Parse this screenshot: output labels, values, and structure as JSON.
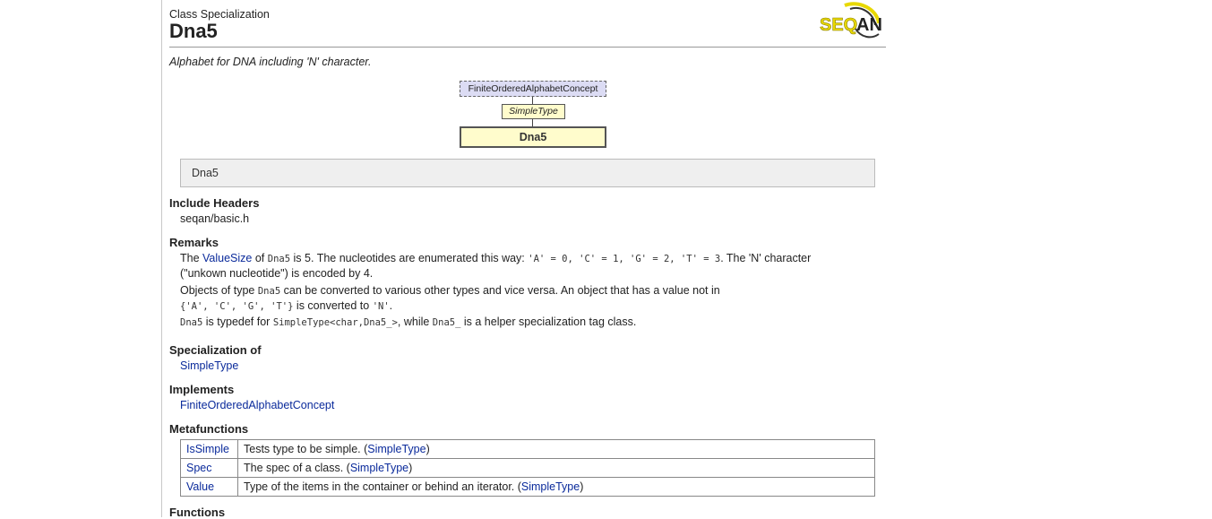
{
  "header": {
    "kind": "Class Specialization",
    "title": "Dna5",
    "logo_text": "SEQAN"
  },
  "summary": "Alphabet for DNA including 'N' character.",
  "diagram": {
    "concept": "FiniteOrderedAlphabetConcept",
    "parent": "SimpleType",
    "self": "Dna5"
  },
  "signature": "Dna5",
  "include": {
    "heading": "Include Headers",
    "header": "seqan/basic.h"
  },
  "remarks": {
    "heading": "Remarks",
    "p1": {
      "t1": "The ",
      "link": "ValueSize",
      "t2": " of ",
      "code1": "Dna5",
      "t3": " is 5. The nucleotides are enumerated this way: ",
      "code2": "'A' = 0, 'C' = 1, 'G' = 2, 'T' = 3",
      "t4": ". The 'N' character",
      "line2": "(\"unkown nucleotide\") is encoded by 4."
    },
    "p2": {
      "t1": "Objects of type ",
      "code1": "Dna5",
      "t2": " can be converted to various other types and vice versa. An object that has a value not in",
      "code2": "{'A', 'C', 'G', 'T'}",
      "t3": " is converted to ",
      "code3": "'N'",
      "t4": "."
    },
    "p3": {
      "code1": "Dna5",
      "t1": " is typedef for ",
      "code2": "SimpleType<char,Dna5_>",
      "t2": ", while ",
      "code3": "Dna5_",
      "t3": " is a helper specialization tag class."
    }
  },
  "specialization": {
    "heading": "Specialization of",
    "link": "SimpleType"
  },
  "implements": {
    "heading": "Implements",
    "link": "FiniteOrderedAlphabetConcept"
  },
  "metafunctions": {
    "heading": "Metafunctions",
    "rows": [
      {
        "name": "IsSimple",
        "desc": "Tests type to be simple. (",
        "link": "SimpleType",
        "end": ")"
      },
      {
        "name": "Spec",
        "desc": "The spec of a class. (",
        "link": "SimpleType",
        "end": ")"
      },
      {
        "name": "Value",
        "desc": "Type of the items in the container or behind an iterator. (",
        "link": "SimpleType",
        "end": ")"
      }
    ]
  },
  "functions": {
    "heading": "Functions"
  },
  "colors": {
    "link": "#0a2a9b",
    "concept_box": "#dcdcf4",
    "type_box": "#fffccc",
    "signature_bg": "#efefef",
    "logo_yellow": "#e8d800"
  }
}
